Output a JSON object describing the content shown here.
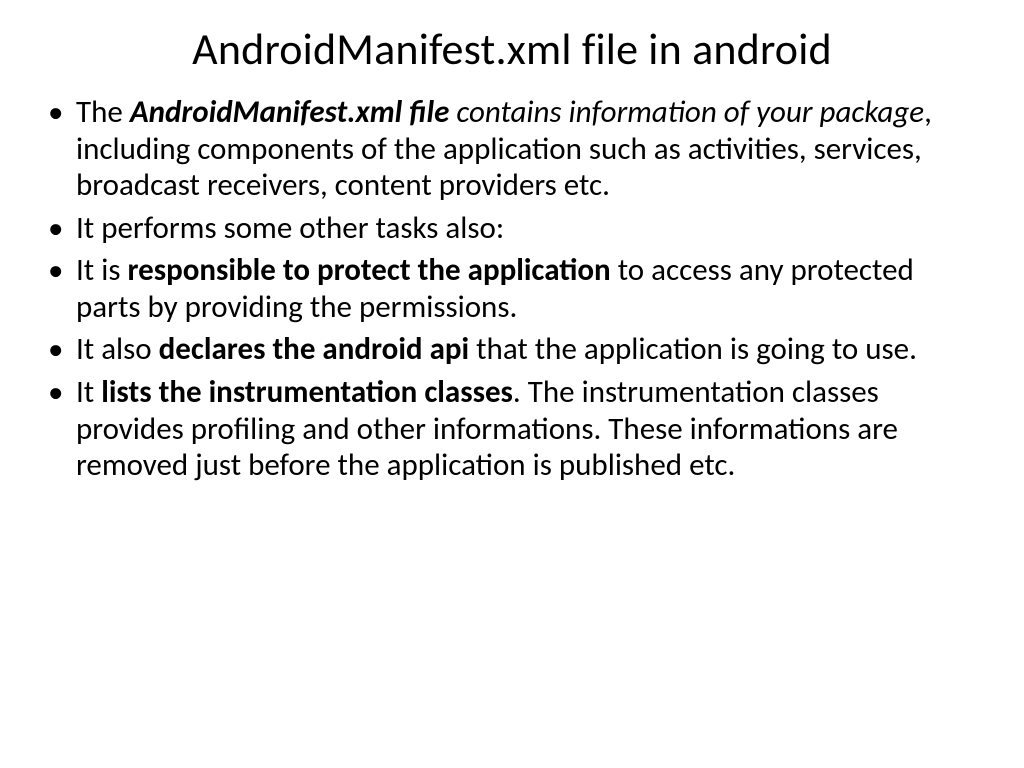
{
  "title": "AndroidManifest.xml file in android",
  "bullets": {
    "b1": {
      "pre": "The ",
      "bold_ital": "AndroidManifest.xml file",
      "ital": " contains information of your package",
      "rest": ", including components of the application such as activities, services, broadcast receivers, content providers etc."
    },
    "b2": {
      "text": "It performs some other tasks also:"
    },
    "b3": {
      "pre": "It is ",
      "bold": "responsible to protect the application",
      "rest": " to access any protected parts by providing the permissions."
    },
    "b4": {
      "pre": "It also ",
      "bold": "declares the android api",
      "rest": " that the application is going to use."
    },
    "b5": {
      "pre": "It ",
      "bold": "lists the instrumentation classes",
      "rest": ". The instrumentation classes provides profiling and other informations. These informations are removed just before the application is published etc."
    }
  }
}
